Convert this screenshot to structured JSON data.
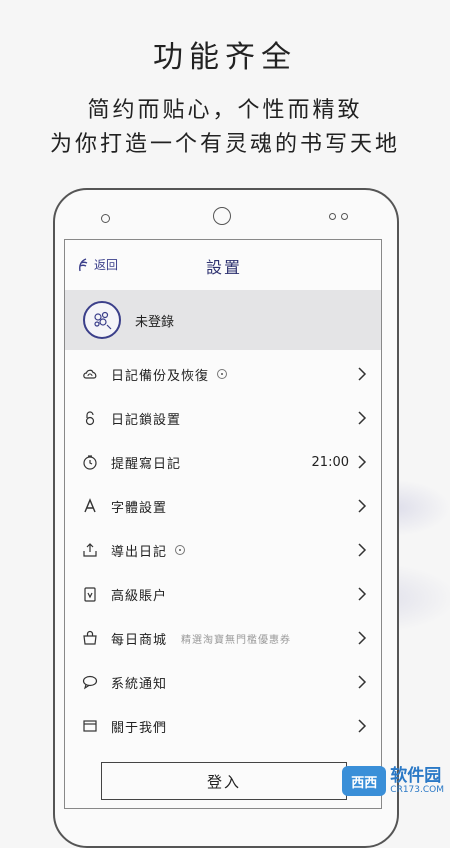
{
  "headline": "功能齐全",
  "subline1": "简约而贴心，个性而精致",
  "subline2": "为你打造一个有灵魂的书写天地",
  "screen": {
    "back_label": "返回",
    "title": "設置",
    "profile_name": "未登錄",
    "items": [
      {
        "label": "日記備份及恢復",
        "icon": "cloud-sync-icon"
      },
      {
        "label": "日記鎖設置",
        "icon": "lock-icon"
      },
      {
        "label": "提醒寫日記",
        "icon": "clock-icon",
        "value": "21:00"
      },
      {
        "label": "字體設置",
        "icon": "font-icon"
      },
      {
        "label": "導出日記",
        "icon": "export-icon"
      },
      {
        "label": "高級賬户",
        "icon": "premium-icon"
      },
      {
        "label": "每日商城",
        "icon": "shopping-bag-icon",
        "hint": "精選淘寶無門檻優惠券"
      },
      {
        "label": "系統通知",
        "icon": "chat-bubble-icon"
      },
      {
        "label": "關于我們",
        "icon": "window-icon"
      }
    ],
    "login_label": "登入"
  },
  "watermark": {
    "logo": "西西",
    "main": "软件园",
    "sub": "CR173.COM"
  }
}
